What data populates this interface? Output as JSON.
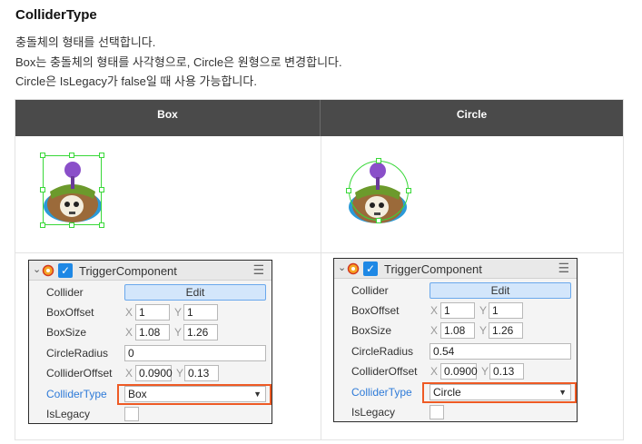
{
  "heading": "ColliderType",
  "description": [
    "충돌체의 형태를 선택합니다.",
    "Box는 충돌체의 형태를 사각형으로, Circle은 원형으로 변경합니다.",
    "Circle은 IsLegacy가 false일 때 사용 가능합니다."
  ],
  "table": {
    "headers": [
      "Box",
      "Circle"
    ]
  },
  "component_name": "TriggerComponent",
  "labels": {
    "collider": "Collider",
    "box_offset": "BoxOffset",
    "box_size": "BoxSize",
    "circle_radius": "CircleRadius",
    "collider_offset": "ColliderOffset",
    "collider_type": "ColliderType",
    "is_legacy": "IsLegacy",
    "edit_button": "Edit",
    "axis_x": "X",
    "axis_y": "Y"
  },
  "panels": [
    {
      "box_offset": {
        "x": "1",
        "y": "1"
      },
      "box_size": {
        "x": "1.08",
        "y": "1.26"
      },
      "circle_radius": "0",
      "collider_offset": {
        "x": "0.0900",
        "y": "0.13"
      },
      "collider_type": "Box",
      "is_legacy": false
    },
    {
      "box_offset": {
        "x": "1",
        "y": "1"
      },
      "box_size": {
        "x": "1.08",
        "y": "1.26"
      },
      "circle_radius": "0.54",
      "collider_offset": {
        "x": "0.0900",
        "y": "0.13"
      },
      "collider_type": "Circle",
      "is_legacy": false
    }
  ],
  "colors": {
    "header_bg": "#4a4a4a",
    "collider_outline": "#38d838",
    "highlight": "#ee5a24",
    "accent_blue": "#1e88e5"
  },
  "icons": [
    "chevron-down-icon",
    "gear-icon",
    "checkbox-checked-icon",
    "menu-icon",
    "dropdown-arrow-icon"
  ]
}
